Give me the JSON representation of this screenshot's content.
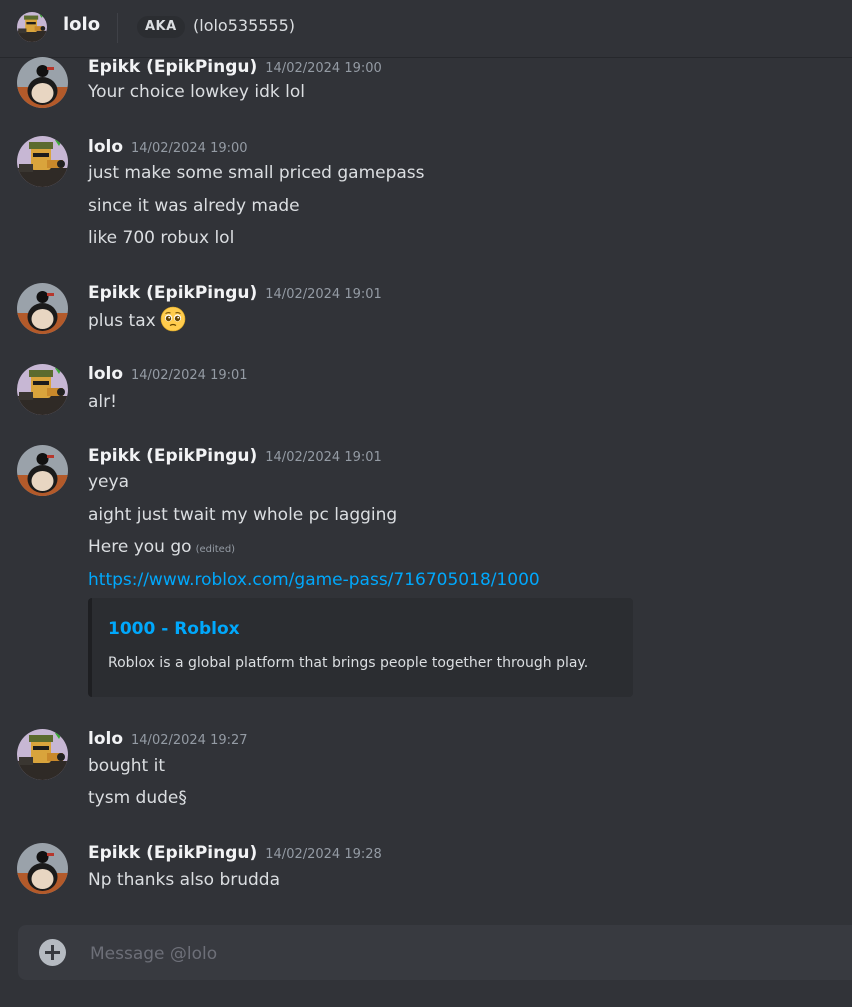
{
  "header": {
    "name": "lolo",
    "aka_label": "AKA",
    "aka_value": "(lolo535555)"
  },
  "icons": {
    "avatar_epikk": "penguin-avatar-icon",
    "avatar_lolo": "soldier-avatar-icon",
    "emoji": "pleading-face-emoji-icon",
    "composer_add": "plus-circle-icon"
  },
  "colors": {
    "background": "#313338",
    "link": "#00a8fc",
    "timestamp": "#949ba4"
  },
  "messages": [
    {
      "author": "Epikk (EpikPingu)",
      "time": "14/02/2024 19:00",
      "lines": [
        "Your choice lowkey idk lol"
      ]
    },
    {
      "author": "lolo",
      "time": "14/02/2024 19:00",
      "lines": [
        "just make some small priced gamepass",
        "since it was alredy made",
        "like 700 robux lol"
      ]
    },
    {
      "author": "Epikk (EpikPingu)",
      "time": "14/02/2024 19:01",
      "lines": [
        "plus tax"
      ]
    },
    {
      "author": "lolo",
      "time": "14/02/2024 19:01",
      "lines": [
        "alr!"
      ]
    },
    {
      "author": "Epikk (EpikPingu)",
      "time": "14/02/2024 19:01",
      "lines": [
        "yeya",
        "aight just twait my whole pc lagging",
        "Here you go",
        "https://www.roblox.com/game-pass/716705018/1000"
      ],
      "edited_label": "(edited)",
      "embed": {
        "title": "1000 - Roblox",
        "description": "Roblox is a global platform that brings people together through play."
      }
    },
    {
      "author": "lolo",
      "time": "14/02/2024 19:27",
      "lines": [
        "bought it",
        "tysm dude§"
      ]
    },
    {
      "author": "Epikk (EpikPingu)",
      "time": "14/02/2024 19:28",
      "lines": [
        "Np thanks also brudda"
      ]
    }
  ],
  "composer": {
    "placeholder": "Message @lolo"
  }
}
